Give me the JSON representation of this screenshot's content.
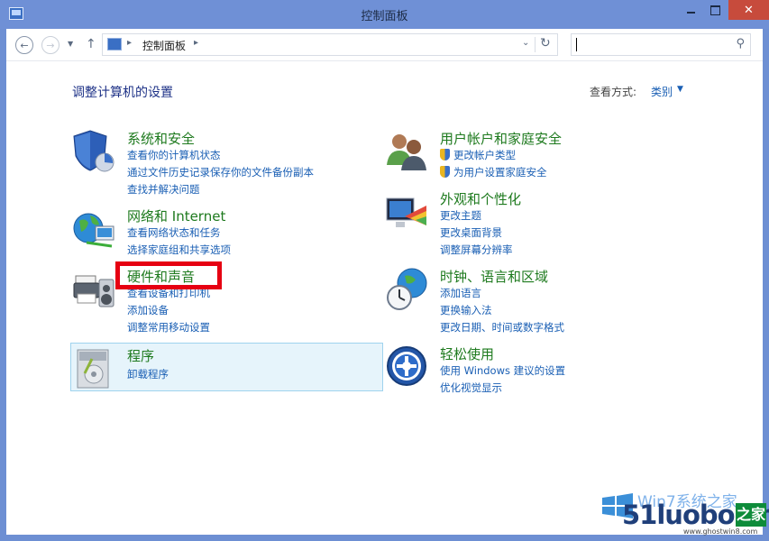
{
  "window": {
    "title": "控制面板"
  },
  "address": {
    "crumb": "控制面板",
    "separator": "▸",
    "search_placeholder": ""
  },
  "content": {
    "page_title": "调整计算机的设置",
    "view_by_label": "查看方式:",
    "view_by_value": "类别"
  },
  "categories": {
    "system_security": {
      "title": "系统和安全",
      "links": [
        "查看你的计算机状态",
        "通过文件历史记录保存你的文件备份副本",
        "查找并解决问题"
      ]
    },
    "network": {
      "title": "网络和 Internet",
      "links": [
        "查看网络状态和任务",
        "选择家庭组和共享选项"
      ]
    },
    "hardware": {
      "title": "硬件和声音",
      "links": [
        "查看设备和打印机",
        "添加设备",
        "调整常用移动设置"
      ]
    },
    "programs": {
      "title": "程序",
      "links": [
        "卸载程序"
      ]
    },
    "user_accounts": {
      "title": "用户帐户和家庭安全",
      "links": [
        "更改帐户类型",
        "为用户设置家庭安全"
      ]
    },
    "appearance": {
      "title": "外观和个性化",
      "links": [
        "更改主题",
        "更改桌面背景",
        "调整屏幕分辨率"
      ]
    },
    "clock": {
      "title": "时钟、语言和区域",
      "links": [
        "添加语言",
        "更换输入法",
        "更改日期、时间或数字格式"
      ]
    },
    "ease": {
      "title": "轻松使用",
      "links": [
        "使用 Windows 建议的设置",
        "优化视觉显示"
      ]
    }
  },
  "watermark": {
    "win_text": "Win7系统之家",
    "brand": "51luobo.cn",
    "zhijia": "之家",
    "url": "www.ghostwin8.com"
  },
  "colors": {
    "title_bar": "#6f90d6",
    "close_button": "#c74b3c",
    "category_title": "#1e7a1e",
    "link": "#1a5fb4",
    "highlight": "#e60012",
    "selected_bg": "#e6f4fb"
  }
}
